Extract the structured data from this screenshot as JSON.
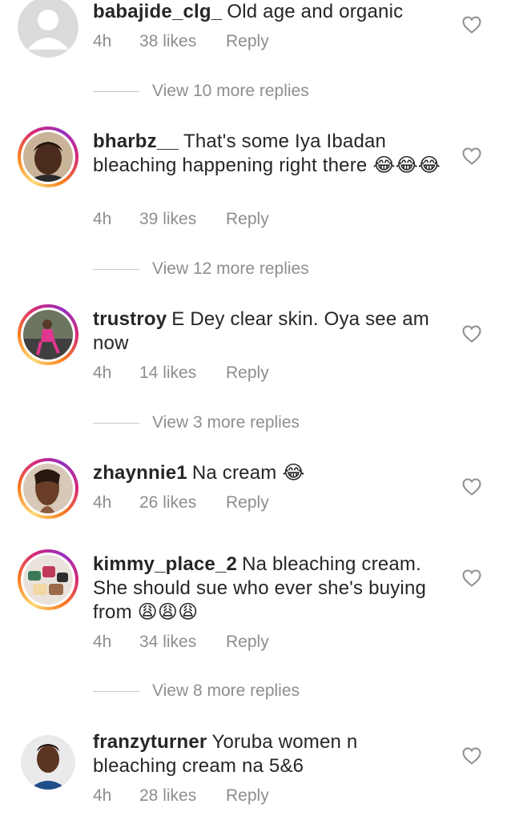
{
  "comments": [
    {
      "username": "babajide_clg_",
      "text": "Old age and organic",
      "time": "4h",
      "likes": "38 likes",
      "reply": "Reply",
      "view_replies": "View 10 more replies"
    },
    {
      "username": "bharbz__",
      "text": "That's some Iya Ibadan bleaching happening right there 😂😂😂",
      "time": "4h",
      "likes": "39 likes",
      "reply": "Reply",
      "view_replies": "View 12 more replies"
    },
    {
      "username": "trustroy",
      "text": "E Dey clear skin. Oya see am now",
      "time": "4h",
      "likes": "14 likes",
      "reply": "Reply",
      "view_replies": "View 3 more replies"
    },
    {
      "username": "zhaynnie1",
      "text": "Na cream 😂",
      "time": "4h",
      "likes": "26 likes",
      "reply": "Reply"
    },
    {
      "username": "kimmy_place_2",
      "text": "Na bleaching cream. She should sue who ever she's buying from 😩😩😩",
      "time": "4h",
      "likes": "34 likes",
      "reply": "Reply",
      "view_replies": "View 8 more replies"
    },
    {
      "username": "franzyturner",
      "text": "Yoruba women n bleaching cream na 5&6",
      "time": "4h",
      "likes": "28 likes",
      "reply": "Reply"
    }
  ],
  "colors": {
    "text": "#262626",
    "secondary": "#8e8e8e",
    "divider": "#c7c7c7",
    "heart_outline": "#8e8e8e"
  },
  "icons": {
    "like": "heart-outline-icon",
    "default_avatar": "default-avatar-icon"
  }
}
